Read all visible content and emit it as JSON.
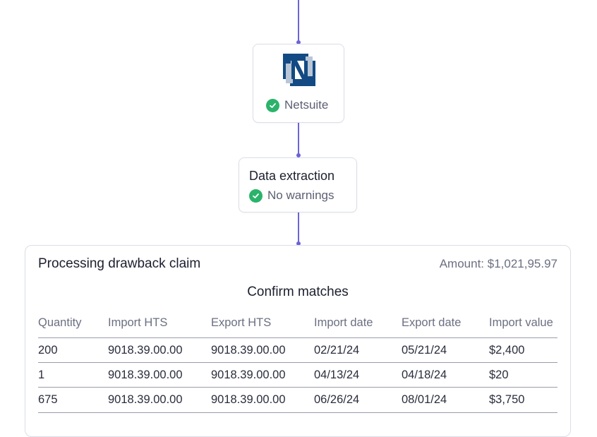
{
  "integration": {
    "name": "Netsuite",
    "logo_icon": "netsuite-logo-icon",
    "status_icon": "check-circle-icon"
  },
  "extraction": {
    "title": "Data extraction",
    "status": "No warnings",
    "status_icon": "check-circle-icon"
  },
  "claim": {
    "title": "Processing drawback claim",
    "amount": "Amount: $1,021,95.97",
    "section_title": "Confirm matches",
    "columns": [
      "Quantity",
      "Import HTS",
      "Export HTS",
      "Import date",
      "Export date",
      "Import value"
    ],
    "rows": [
      [
        "200",
        "9018.39.00.00",
        "9018.39.00.00",
        "02/21/24",
        "05/21/24",
        "$2,400"
      ],
      [
        "1",
        "9018.39.00.00",
        "9018.39.00.00",
        "04/13/24",
        "04/18/24",
        "$20"
      ],
      [
        "675",
        "9018.39.00.00",
        "9018.39.00.00",
        "06/26/24",
        "08/01/24",
        "$3,750"
      ]
    ]
  },
  "colors": {
    "accent": "#6c63d8",
    "success": "#2bb36b",
    "logo_dark": "#134a83",
    "logo_light": "#b9c6d6"
  }
}
